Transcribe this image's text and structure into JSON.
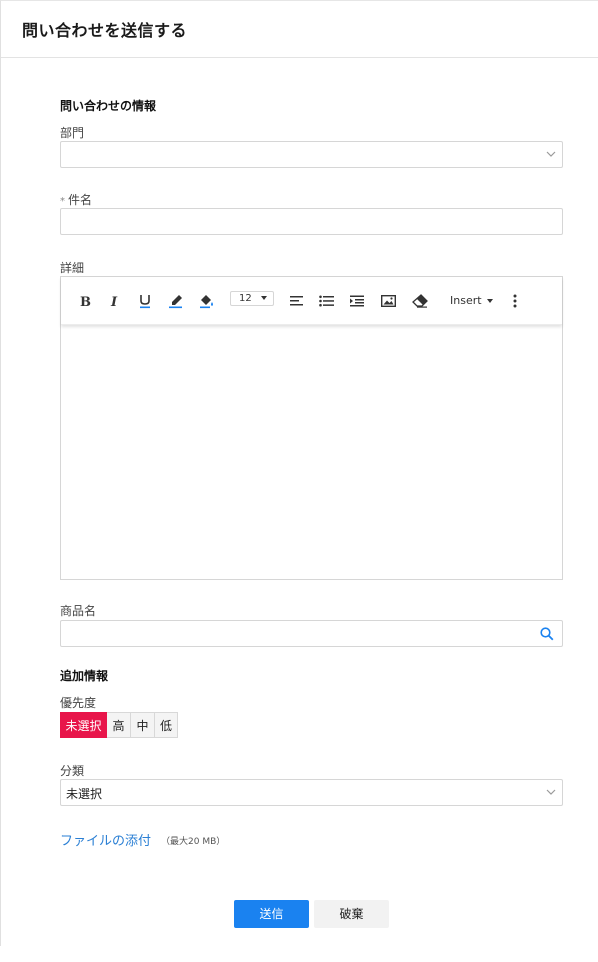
{
  "header": {
    "title": "問い合わせを送信する"
  },
  "inquiry": {
    "section_title": "問い合わせの情報",
    "department_label": "部門",
    "department_value": "",
    "subject_required_mark": "*",
    "subject_label": "件名",
    "subject_value": "",
    "details_label": "詳細",
    "details_value": ""
  },
  "editor_toolbar": {
    "font_size": "12",
    "insert_label": "Insert",
    "icons": [
      "bold-icon",
      "italic-icon",
      "underline-icon",
      "highlight-pen-icon",
      "fill-color-icon",
      "align-left-icon",
      "bullet-list-icon",
      "indent-icon",
      "image-icon",
      "eraser-icon",
      "more-vertical-icon"
    ],
    "accent_color": "#1a82f0"
  },
  "product": {
    "label": "商品名",
    "value": "",
    "icon": "search-icon"
  },
  "additional": {
    "section_title": "追加情報",
    "priority_label": "優先度",
    "priority_options": [
      "未選択",
      "高",
      "中",
      "低"
    ],
    "priority_selected": "未選択",
    "priority_active_color": "#e8154a",
    "category_label": "分類",
    "category_value": "未選択"
  },
  "attachment": {
    "link_label": "ファイルの添付",
    "note": "（最大20 MB）"
  },
  "actions": {
    "submit_label": "送信",
    "discard_label": "破棄",
    "submit_color": "#1a82f0"
  }
}
